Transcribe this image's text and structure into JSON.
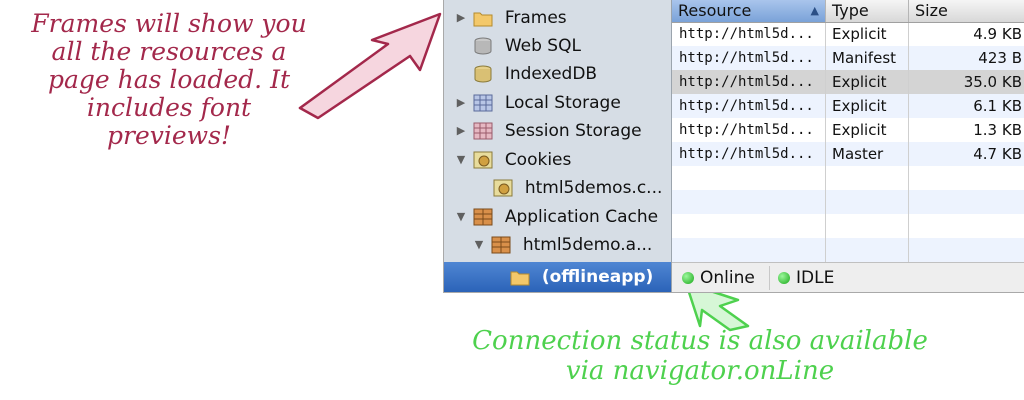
{
  "annotations": {
    "top_note_lines": [
      "Frames will show you",
      "all the resources a",
      "page has loaded. It",
      "includes font",
      "previews!"
    ],
    "bottom_note_lines": [
      "Connection status is also available",
      "via navigator.onLine"
    ],
    "top_color": "#a3284b",
    "bottom_color": "#4ed14e"
  },
  "sidebar": {
    "items": [
      {
        "label": "Frames",
        "icon": "folder-icon",
        "expander": "collapsed"
      },
      {
        "label": "Web SQL",
        "icon": "database-icon",
        "expander": "none"
      },
      {
        "label": "IndexedDB",
        "icon": "database-icon",
        "expander": "none"
      },
      {
        "label": "Local Storage",
        "icon": "storage-grid-icon",
        "expander": "collapsed"
      },
      {
        "label": "Session Storage",
        "icon": "storage-grid-icon",
        "expander": "collapsed"
      },
      {
        "label": "Cookies",
        "icon": "cookie-icon",
        "expander": "expanded"
      },
      {
        "label": "html5demos.c...",
        "icon": "cookie-icon",
        "expander": "none"
      },
      {
        "label": "Application Cache",
        "icon": "app-cache-icon",
        "expander": "expanded"
      },
      {
        "label": "html5demo.a...",
        "icon": "app-cache-icon",
        "expander": "expanded"
      },
      {
        "label": "(offlineapp)",
        "icon": "folder-icon",
        "expander": "none",
        "selected": true
      }
    ]
  },
  "table": {
    "columns": [
      "Resource",
      "Type",
      "Size"
    ],
    "sort_indicator": "▲",
    "rows": [
      {
        "resource": "http://html5d...",
        "type": "Explicit",
        "size": "4.9 KB"
      },
      {
        "resource": "http://html5d...",
        "type": "Manifest",
        "size": "423 B"
      },
      {
        "resource": "http://html5d...",
        "type": "Explicit",
        "size": "35.0 KB",
        "highlighted": true
      },
      {
        "resource": "http://html5d...",
        "type": "Explicit",
        "size": "6.1 KB"
      },
      {
        "resource": "http://html5d...",
        "type": "Explicit",
        "size": "1.3 KB"
      },
      {
        "resource": "http://html5d...",
        "type": "Master",
        "size": "4.7 KB"
      }
    ]
  },
  "status_bar": {
    "connection": "Online",
    "cache_status": "IDLE",
    "indicator_color": "#22b322"
  }
}
